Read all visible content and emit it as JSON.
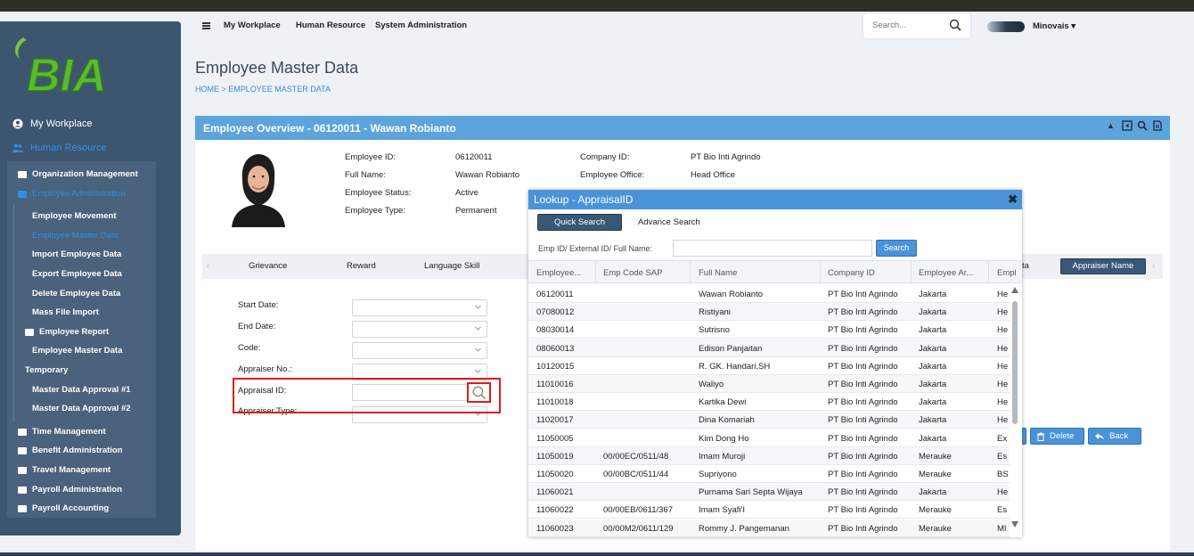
{
  "header": {
    "nav": [
      "My Workplace",
      "Human Resource",
      "System Administration"
    ],
    "search_placeholder": "Search...",
    "user": "Minovais"
  },
  "sidebar": {
    "logo_text": "BIA",
    "top": [
      "My Workplace",
      "Human Resource"
    ],
    "items": [
      {
        "label": "Organization Management"
      },
      {
        "label": "Employee Administration"
      },
      {
        "label": "Employee Movement"
      },
      {
        "label": "Employee Master Data"
      },
      {
        "label": "Import Employee Data"
      },
      {
        "label": "Export Employee Data"
      },
      {
        "label": "Delete Employee Data"
      },
      {
        "label": "Mass File Import"
      },
      {
        "label": "Employee Report"
      },
      {
        "label": "Employee Master Data"
      },
      {
        "label": "Temporary"
      },
      {
        "label": "Master Data Approval #1"
      },
      {
        "label": "Master Data Approval #2"
      },
      {
        "label": "Time Management"
      },
      {
        "label": "Benefit Administration"
      },
      {
        "label": "Travel Management"
      },
      {
        "label": "Payroll Administration"
      },
      {
        "label": "Payroll Accounting"
      }
    ]
  },
  "page": {
    "title": "Employee Master Data",
    "breadcrumb": "HOME > EMPLOYEE MASTER DATA",
    "card_title": "Employee Overview - 06120011 - Wawan Robianto"
  },
  "employee": {
    "labels": [
      "Employee ID:",
      "Full Name:",
      "Employee Status:",
      "Employee Type:",
      "Company ID:",
      "Employee Office:"
    ],
    "values": [
      "06120011",
      "Wawan Robianto",
      "Active",
      "Permanent",
      "PT Bio Inti Agrindo",
      "Head Office"
    ]
  },
  "tabs": [
    "Grievance",
    "Reward",
    "Language Skill",
    "ta",
    "Appraiser Name"
  ],
  "form": {
    "labels": [
      "Start Date:",
      "End Date:",
      "Code:",
      "Appraiser No.:",
      "Appraisal ID:",
      "Appraiser Type:"
    ]
  },
  "actions": {
    "delete": "Delete",
    "back": "Back"
  },
  "modal": {
    "title": "Lookup - AppraisalID",
    "tab_quick": "Quick Search",
    "tab_advance": "Advance Search",
    "search_label": "Emp ID/ External ID/ Full Name:",
    "search_button": "Search",
    "columns": [
      "Employee...",
      "Emp Code SAP",
      "Full Name",
      "Company ID",
      "Employee Ar...",
      "Emplo"
    ],
    "rows": [
      [
        "06120011",
        "",
        "Wawan Robianto",
        "PT Bio Inti Agrindo",
        "Jakarta",
        "He"
      ],
      [
        "07080012",
        "",
        "Ristiyani",
        "PT Bio Inti Agrindo",
        "Jakarta",
        "He"
      ],
      [
        "08030014",
        "",
        "Sutrisno",
        "PT Bio Inti Agrindo",
        "Jakarta",
        "He"
      ],
      [
        "08060013",
        "",
        "Edison Panjaitan",
        "PT Bio Inti Agrindo",
        "Jakarta",
        "He"
      ],
      [
        "10120015",
        "",
        "R. GK. Handari,SH",
        "PT Bio Inti Agrindo",
        "Jakarta",
        "He"
      ],
      [
        "11010016",
        "",
        "Waliyo",
        "PT Bio Inti Agrindo",
        "Jakarta",
        "He"
      ],
      [
        "11010018",
        "",
        "Kartika Dewi",
        "PT Bio Inti Agrindo",
        "Jakarta",
        "He"
      ],
      [
        "11020017",
        "",
        "Dina Komariah",
        "PT Bio Inti Agrindo",
        "Jakarta",
        "He"
      ],
      [
        "11050005",
        "",
        "Kim Dong Ho",
        "PT Bio Inti Agrindo",
        "Jakarta",
        "Ex"
      ],
      [
        "11050019",
        "00/00EC/0511/48",
        "Imam Muroji",
        "PT Bio Inti Agrindo",
        "Merauke",
        "Es"
      ],
      [
        "11050020",
        "00/00BC/0511/44",
        "Supriyono",
        "PT Bio Inti Agrindo",
        "Merauke",
        "BS"
      ],
      [
        "11060021",
        "",
        "Purnama Sari Septa Wijaya",
        "PT Bio Inti Agrindo",
        "Jakarta",
        "He"
      ],
      [
        "11060022",
        "00/00EB/0611/367",
        "Imam Syafi'I",
        "PT Bio Inti Agrindo",
        "Merauke",
        "Es"
      ],
      [
        "11060023",
        "00/00M2/0611/129",
        "Rommy J. Pangemanan",
        "PT Bio Inti Agrindo",
        "Merauke",
        "MI"
      ]
    ]
  }
}
